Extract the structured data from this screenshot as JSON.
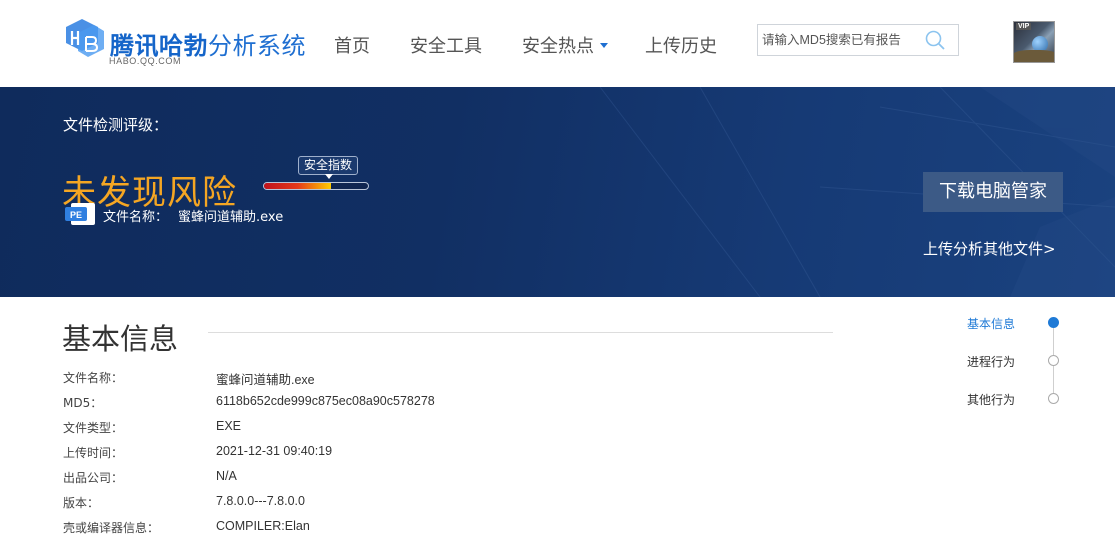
{
  "header": {
    "brand_bold": "腾讯哈勃",
    "brand_rest": "分析系统",
    "brand_sub": "HABO.QQ.COM",
    "nav": {
      "home": "首页",
      "tools": "安全工具",
      "hot": "安全热点",
      "history": "上传历史"
    },
    "search_placeholder": "请输入MD5搜索已有报告",
    "avatar_badge": "VIP"
  },
  "banner": {
    "rating_label": "文件检测评级：",
    "result": "未发现风险",
    "gauge_label": "安全指数",
    "gauge_level": 0.64,
    "file_icon_text": "PE",
    "file_name_label": "文件名称：",
    "file_name": "蜜蜂问道辅助.exe",
    "download_button": "下载电脑管家",
    "upload_link": "上传分析其他文件>"
  },
  "basic_info": {
    "title": "基本信息",
    "rows": [
      {
        "label": "文件名称：",
        "value": "蜜蜂问道辅助.exe"
      },
      {
        "label": "MD5：",
        "value": "6118b652cde999c875ec08a90c578278"
      },
      {
        "label": "文件类型：",
        "value": "EXE"
      },
      {
        "label": "上传时间：",
        "value": "2021-12-31 09:40:19"
      },
      {
        "label": "出品公司：",
        "value": "N/A"
      },
      {
        "label": "版本：",
        "value": "7.8.0.0---7.8.0.0"
      },
      {
        "label": "壳或编译器信息：",
        "value": "COMPILER:Elan"
      }
    ]
  },
  "timeline": {
    "items": [
      {
        "label": "基本信息",
        "active": true
      },
      {
        "label": "进程行为",
        "active": false
      },
      {
        "label": "其他行为",
        "active": false
      }
    ]
  },
  "colors": {
    "brand": "#1f6fd1",
    "banner": "#112f63",
    "result": "#f5a623",
    "active": "#1f7ad6"
  }
}
